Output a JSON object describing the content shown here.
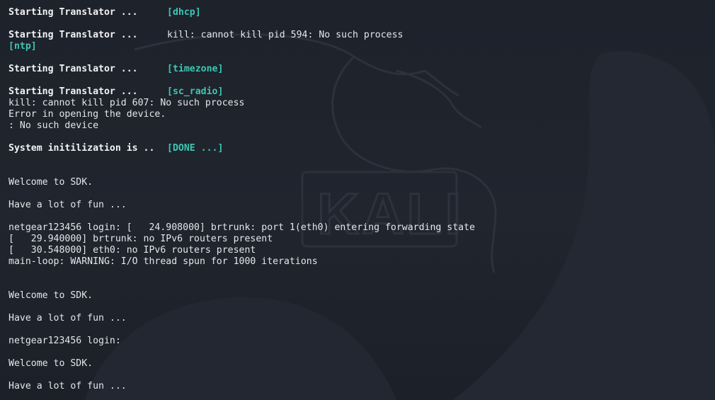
{
  "lines": [
    {
      "kind": "translator",
      "prefix": "Starting Translator ...",
      "tag": "[dhcp]"
    },
    {
      "kind": "blank"
    },
    {
      "kind": "translator_msg",
      "prefix": "Starting Translator ...",
      "msg": "kill: cannot kill pid 594: No such process"
    },
    {
      "kind": "tag",
      "tag": "[ntp]"
    },
    {
      "kind": "blank"
    },
    {
      "kind": "translator",
      "prefix": "Starting Translator ...",
      "tag": "[timezone]"
    },
    {
      "kind": "blank"
    },
    {
      "kind": "translator",
      "prefix": "Starting Translator ...",
      "tag": "[sc_radio]"
    },
    {
      "kind": "text",
      "text": "kill: cannot kill pid 607: No such process"
    },
    {
      "kind": "text",
      "text": "Error in opening the device."
    },
    {
      "kind": "text",
      "text": ": No such device"
    },
    {
      "kind": "blank"
    },
    {
      "kind": "translator",
      "prefix": "System initilization is ..",
      "tag": "[DONE ...]"
    },
    {
      "kind": "blank"
    },
    {
      "kind": "blank"
    },
    {
      "kind": "text",
      "text": "Welcome to SDK."
    },
    {
      "kind": "blank"
    },
    {
      "kind": "text",
      "text": "Have a lot of fun ..."
    },
    {
      "kind": "blank"
    },
    {
      "kind": "text",
      "text": "netgear123456 login: [   24.908000] brtrunk: port 1(eth0) entering forwarding state"
    },
    {
      "kind": "text",
      "text": "[   29.940000] brtrunk: no IPv6 routers present"
    },
    {
      "kind": "text",
      "text": "[   30.548000] eth0: no IPv6 routers present"
    },
    {
      "kind": "text",
      "text": "main-loop: WARNING: I/O thread spun for 1000 iterations"
    },
    {
      "kind": "blank"
    },
    {
      "kind": "blank"
    },
    {
      "kind": "text",
      "text": "Welcome to SDK."
    },
    {
      "kind": "blank"
    },
    {
      "kind": "text",
      "text": "Have a lot of fun ..."
    },
    {
      "kind": "blank"
    },
    {
      "kind": "text",
      "text": "netgear123456 login:"
    },
    {
      "kind": "blank"
    },
    {
      "kind": "text",
      "text": "Welcome to SDK."
    },
    {
      "kind": "blank"
    },
    {
      "kind": "text",
      "text": "Have a lot of fun ..."
    }
  ],
  "wallpaper": {
    "logo_text": "KALI",
    "colors": {
      "background": "#1e222b",
      "shape": "#262b35",
      "accent": "#3ec6b3"
    }
  }
}
